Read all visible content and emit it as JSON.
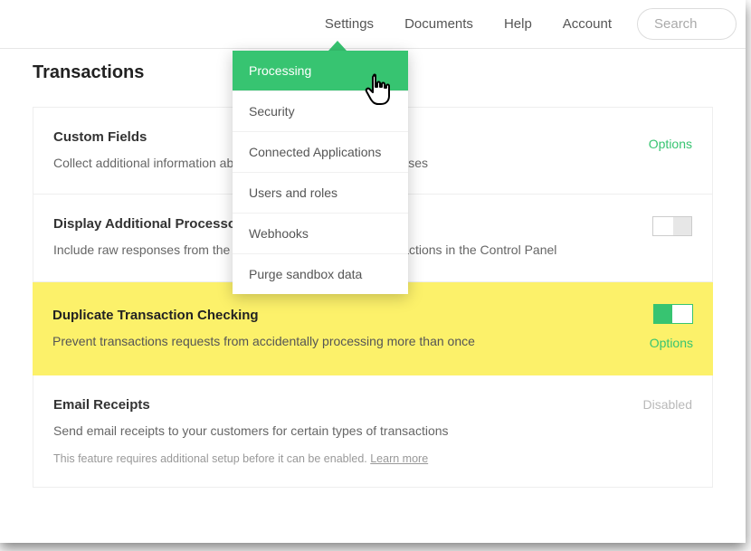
{
  "nav": {
    "settings": "Settings",
    "documents": "Documents",
    "help": "Help",
    "account": "Account"
  },
  "search": {
    "placeholder": "Search"
  },
  "page": {
    "title": "Transactions"
  },
  "dropdown": {
    "items": [
      {
        "label": "Processing"
      },
      {
        "label": "Security"
      },
      {
        "label": "Connected Applications"
      },
      {
        "label": "Users and roles"
      },
      {
        "label": "Webhooks"
      },
      {
        "label": "Purge sandbox data"
      }
    ]
  },
  "sections": {
    "custom_fields": {
      "title": "Custom Fields",
      "desc": "Collect additional information about your customers and purchases",
      "options": "Options"
    },
    "processor_resp": {
      "title": "Display Additional Processor Response",
      "desc": "Include raw responses from the processor for credit card transactions in the Control Panel"
    },
    "dup_check": {
      "title": "Duplicate Transaction Checking",
      "desc": "Prevent transactions requests from accidentally processing more than once",
      "options": "Options"
    },
    "email_receipts": {
      "title": "Email Receipts",
      "desc": "Send email receipts to your customers for certain types of transactions",
      "note_prefix": "This feature requires additional setup before it can be enabled. ",
      "learn": "Learn more",
      "status": "Disabled"
    }
  }
}
